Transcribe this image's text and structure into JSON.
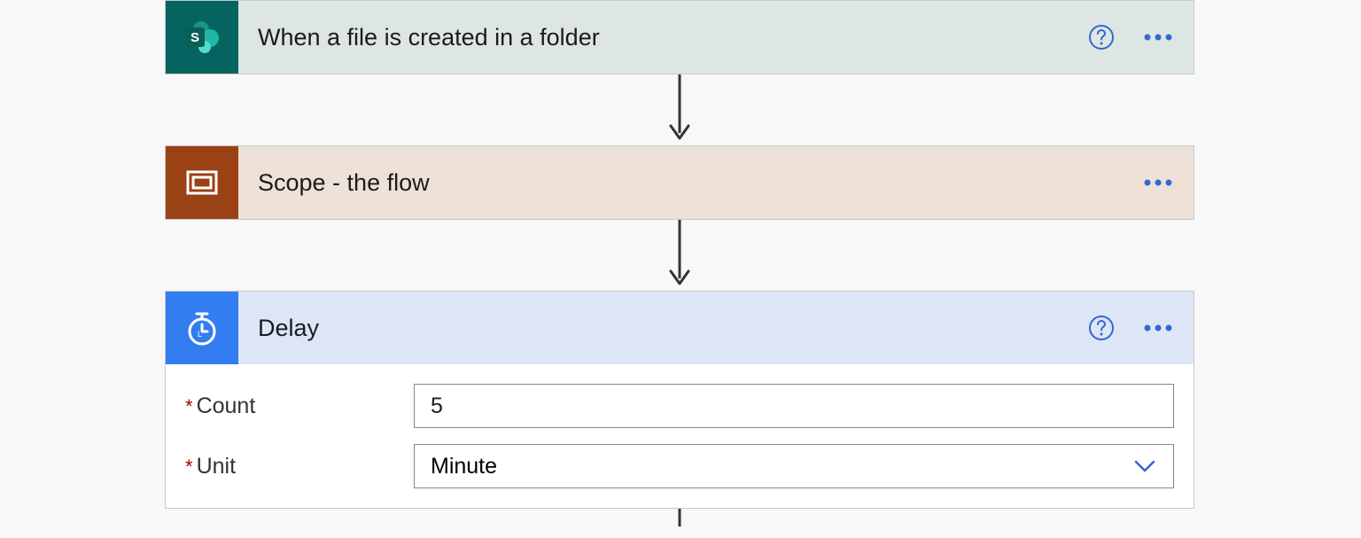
{
  "cards": {
    "trigger": {
      "title": "When a file is created in a folder",
      "icon_name": "sharepoint-icon",
      "has_help": true
    },
    "scope": {
      "title": "Scope - the flow",
      "icon_name": "scope-icon",
      "has_help": false
    },
    "delay": {
      "title": "Delay",
      "icon_name": "timer-icon",
      "has_help": true,
      "fields": {
        "count": {
          "label": "Count",
          "required": true,
          "value": "5"
        },
        "unit": {
          "label": "Unit",
          "required": true,
          "value": "Minute"
        }
      }
    }
  },
  "colors": {
    "help_icon": "#3468d1",
    "ellipsis": "#3468d1",
    "required": "#a80000",
    "chevron": "#3468d1"
  }
}
